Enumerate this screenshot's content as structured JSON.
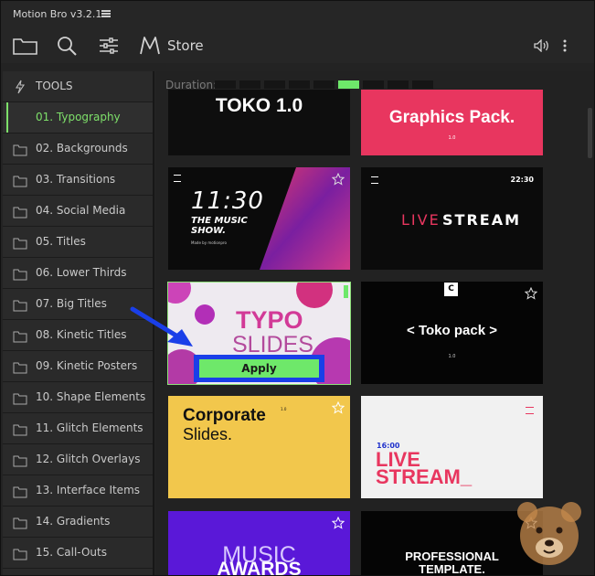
{
  "window": {
    "title": "Motion Bro v3.2.1"
  },
  "toolbar": {
    "folder_icon": "folder-icon",
    "search_icon": "search-icon",
    "filters_icon": "sliders-icon",
    "store_label": "Store",
    "volume_icon": "volume-icon",
    "more_icon": "more-vertical-icon"
  },
  "sidebar": {
    "items": [
      {
        "label": "TOOLS",
        "icon": "bolt-icon"
      },
      {
        "label": "01. Typography",
        "icon": "folder-icon",
        "active": true
      },
      {
        "label": "02. Backgrounds",
        "icon": "folder-icon"
      },
      {
        "label": "03. Transitions",
        "icon": "folder-icon"
      },
      {
        "label": "04. Social Media",
        "icon": "folder-icon"
      },
      {
        "label": "05. Titles",
        "icon": "folder-icon"
      },
      {
        "label": "06. Lower Thirds",
        "icon": "folder-icon"
      },
      {
        "label": "07. Big Titles",
        "icon": "folder-icon"
      },
      {
        "label": "08. Kinetic Titles",
        "icon": "folder-icon"
      },
      {
        "label": "09. Kinetic Posters",
        "icon": "folder-icon"
      },
      {
        "label": "10. Shape Elements",
        "icon": "folder-icon"
      },
      {
        "label": "11. Glitch Elements",
        "icon": "folder-icon"
      },
      {
        "label": "12. Glitch Overlays",
        "icon": "folder-icon"
      },
      {
        "label": "13. Interface Items",
        "icon": "folder-icon"
      },
      {
        "label": "14. Gradients",
        "icon": "folder-icon"
      },
      {
        "label": "15. Call-Outs",
        "icon": "folder-icon"
      }
    ]
  },
  "duration": {
    "label": "Duration:",
    "segments": 9,
    "active_segment": 6
  },
  "thumbnails": [
    {
      "title": "TOKO 1.0"
    },
    {
      "title": "Graphics Pack.",
      "sub": "1.0"
    },
    {
      "time": "11:30",
      "line1": "THE MUSIC",
      "line2": "SHOW.",
      "small": "Made by motionpro"
    },
    {
      "time": "22:30",
      "word1": "LIVE",
      "word2": "STREAM"
    },
    {
      "word1": "TYPO",
      "word2": "SLIDES"
    },
    {
      "badge": "C",
      "title": "< Toko pack >",
      "sub": "1.0"
    },
    {
      "line1": "Corporate",
      "line2": "Slides.",
      "sup": "1.0"
    },
    {
      "time": "16:00",
      "word1": "LIVE",
      "word2": "STREAM_"
    },
    {
      "word1": "MUSIC",
      "word2": "AWARDS"
    },
    {
      "line1": "PROFESSIONAL",
      "line2": "TEMPLATE."
    }
  ],
  "apply": {
    "label": "Apply"
  },
  "colors": {
    "accent_green": "#6ee86a",
    "highlight_blue": "#1a3fe8",
    "pink": "#e8365f",
    "purple": "#5a18d8",
    "yellow": "#f2c74c"
  }
}
